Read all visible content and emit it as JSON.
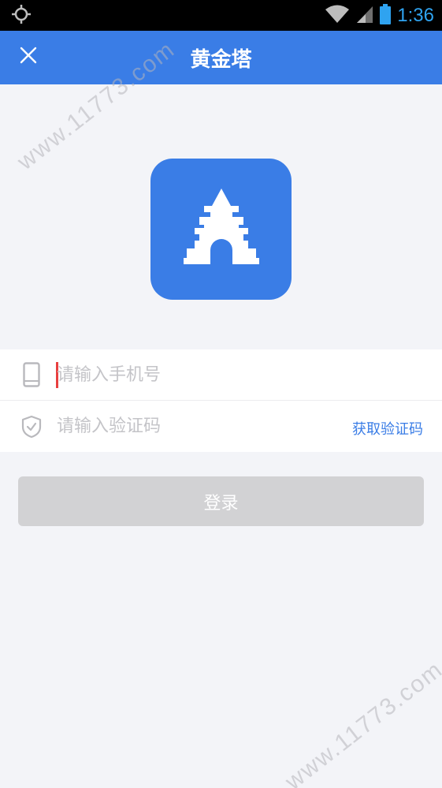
{
  "status_bar": {
    "time": "1:36",
    "icons": [
      "location-icon",
      "wifi-icon",
      "cell-signal-icon",
      "battery-icon"
    ]
  },
  "app_bar": {
    "title": "黄金塔",
    "close_icon": "close-icon"
  },
  "logo": {
    "icon": "tower-icon",
    "tile_color": "#3a7de6"
  },
  "form": {
    "phone_placeholder": "请输入手机号",
    "phone_value": "",
    "code_placeholder": "请输入验证码",
    "code_value": "",
    "get_code_label": "获取验证码"
  },
  "login": {
    "label": "登录"
  },
  "watermark": {
    "text": "www.11773.com"
  },
  "colors": {
    "accent": "#3a7de6",
    "background": "#f3f4f8",
    "disabled_button": "#d2d2d4",
    "caret": "#e84040"
  }
}
